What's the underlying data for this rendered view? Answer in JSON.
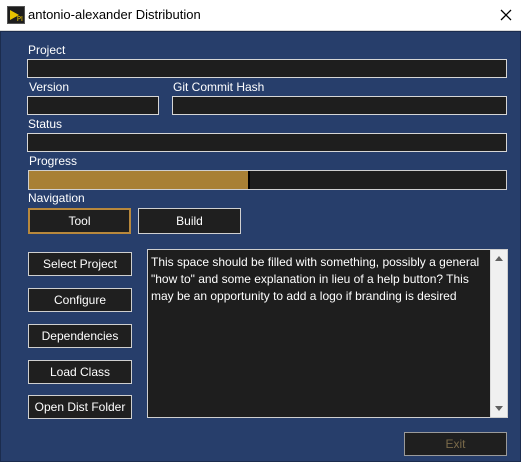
{
  "window": {
    "title": "antonio-alexander Distribution"
  },
  "form": {
    "project_label": "Project",
    "project_value": "",
    "version_label": "Version",
    "version_value": "",
    "git_label": "Git Commit Hash",
    "git_value": "",
    "status_label": "Status",
    "status_value": "",
    "progress_label": "Progress",
    "progress_fraction": 0.46
  },
  "navigation": {
    "label": "Navigation",
    "tabs": [
      {
        "label": "Tool",
        "active": true
      },
      {
        "label": "Build",
        "active": false
      }
    ]
  },
  "actions": [
    {
      "label": "Select Project"
    },
    {
      "label": "Configure"
    },
    {
      "label": "Dependencies"
    },
    {
      "label": "Load Class"
    },
    {
      "label": "Open Dist Folder"
    }
  ],
  "help_text": "This space should be filled with something, possibly a general \"how to\" and some explanation in lieu of a help button? This may be an opportunity to add a logo if branding is desired",
  "footer": {
    "exit_label": "Exit"
  },
  "colors": {
    "background": "#273e6b",
    "field": "#1e1e1e",
    "progress_fill": "#a88035",
    "active_tab_border": "#b8883c"
  },
  "icons": {
    "app": "labview-app-icon",
    "close": "close-icon"
  }
}
